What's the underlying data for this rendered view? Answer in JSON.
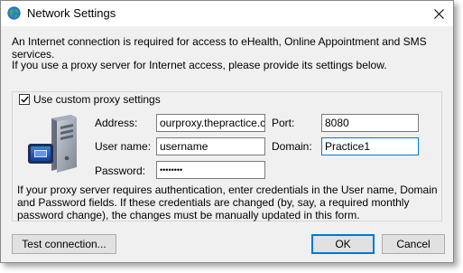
{
  "window": {
    "title": "Network Settings"
  },
  "intro": {
    "line1": "An Internet connection is required for access to eHealth, Online Appointment and SMS services.",
    "line2": "If you use a proxy server for Internet access, please provide its settings below."
  },
  "proxy": {
    "checkbox_label": "Use custom proxy settings",
    "checked": true,
    "address_label": "Address:",
    "address_value": "ourproxy.thepractice.com",
    "port_label": "Port:",
    "port_value": "8080",
    "username_label": "User name:",
    "username_value": "username",
    "domain_label": "Domain:",
    "domain_value": "Practice1",
    "password_label": "Password:",
    "password_value": "••••••••",
    "note": "If your proxy server requires authentication, enter credentials in the User name, Domain and Password fields. If these credentials are changed (by, say, a required monthly password change), the changes must be manually updated in this form."
  },
  "buttons": {
    "test": "Test connection...",
    "ok": "OK",
    "cancel": "Cancel"
  },
  "colors": {
    "accent": "#0078d7",
    "dialog_bg": "#f0f0f0"
  }
}
